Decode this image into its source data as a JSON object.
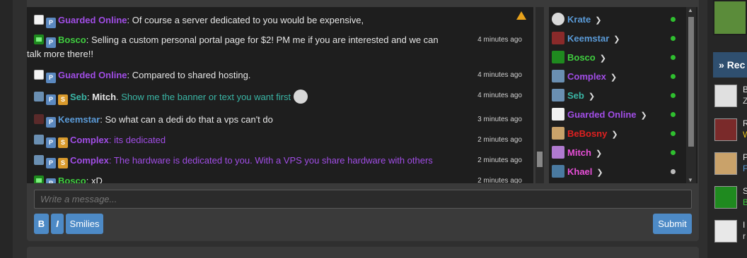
{
  "colors": {
    "accent": "#4d8ac6",
    "online": "#2fbf2f",
    "away": "#bbbbbb",
    "purple": "#a14de6",
    "green": "#3fcf3f",
    "blue": "#5b9bd8",
    "teal": "#3ab5a5",
    "red": "#e02020",
    "pink": "#e84fd8",
    "orange": "#e8a21b"
  },
  "messages": [
    {
      "user": "Guarded Online",
      "user_color": "#a14de6",
      "text": "Of course a server dedicated to you would be expensive,",
      "time": "",
      "text_color": "#e6e6e6"
    },
    {
      "user": "Bosco",
      "user_color": "#3fcf3f",
      "text": "Selling a custom personal portal page for $2! PM me if you are interested and we can",
      "text2": "talk more there!!",
      "time": "4 minutes ago",
      "text_color": "#e6e6e6"
    },
    {
      "user": "Guarded Online",
      "user_color": "#a14de6",
      "text": "Compared to shared hosting.",
      "time": "4 minutes ago",
      "text_color": "#e6e6e6"
    },
    {
      "user": "Seb",
      "user_color": "#3ab5a5",
      "mention": "Mitch",
      "text": "Show me the banner or text you want first",
      "time": "4 minutes ago",
      "text_color": "#3ab5a5"
    },
    {
      "user": "Keemstar",
      "user_color": "#5b9bd8",
      "text": "So what can a dedi do that a vps can't do",
      "time": "3 minutes ago",
      "text_color": "#e6e6e6"
    },
    {
      "user": "Complex",
      "user_color": "#a14de6",
      "text": "its dedicated",
      "time": "2 minutes ago",
      "text_color": "#a14de6"
    },
    {
      "user": "Complex",
      "user_color": "#a14de6",
      "text": "The hardware is dedicated to you. With a VPS you share hardware with others",
      "time": "2 minutes ago",
      "text_color": "#a14de6"
    },
    {
      "user": "Bosco",
      "user_color": "#3fcf3f",
      "text": "xD",
      "time": "2 minutes ago",
      "text_color": "#e6e6e6"
    }
  ],
  "users": [
    {
      "name": "Krate",
      "color": "#5b9bd8",
      "status": "online"
    },
    {
      "name": "Keemstar",
      "color": "#5b9bd8",
      "status": "online"
    },
    {
      "name": "Bosco",
      "color": "#3fcf3f",
      "status": "online"
    },
    {
      "name": "Complex",
      "color": "#a14de6",
      "status": "online"
    },
    {
      "name": "Seb",
      "color": "#3ab5a5",
      "status": "online"
    },
    {
      "name": "Guarded Online",
      "color": "#a14de6",
      "status": "online"
    },
    {
      "name": "BeBosny",
      "color": "#e02020",
      "status": "online"
    },
    {
      "name": "Mitch",
      "color": "#e84fd8",
      "status": "online"
    },
    {
      "name": "Khael",
      "color": "#e84fd8",
      "status": "away"
    }
  ],
  "composer": {
    "placeholder": "Write a message...",
    "bold": "B",
    "italic": "I",
    "smilies": "Smilies",
    "submit": "Submit"
  },
  "sidebar": {
    "header": "Rec",
    "items": [
      {
        "l1": "B",
        "l2": "Z"
      },
      {
        "l1": "R",
        "l2": "W"
      },
      {
        "l1": "P",
        "l2": "F"
      },
      {
        "l1": "S",
        "l2": "B"
      },
      {
        "l1": "I",
        "l2": "r"
      }
    ]
  }
}
